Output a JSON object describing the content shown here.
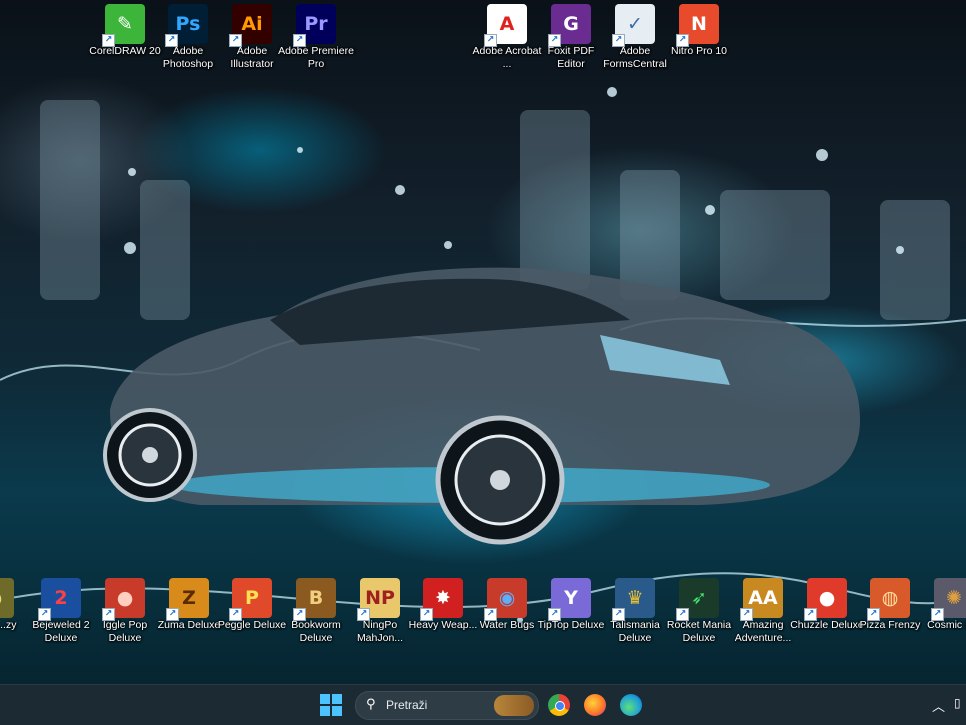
{
  "desktop": {
    "wallpaper": "car-water-splash",
    "top_icons": [
      {
        "name": "coreldraw",
        "label": "CorelDRAW 20",
        "glyph": "✎",
        "bg": "#3cb53a",
        "fg": "#ffffff"
      },
      {
        "name": "photoshop",
        "label": "Adobe Photoshop",
        "glyph": "Ps",
        "bg": "#001e36",
        "fg": "#31a8ff"
      },
      {
        "name": "illustrator",
        "label": "Adobe Illustrator",
        "glyph": "Ai",
        "bg": "#330000",
        "fg": "#ff9a00"
      },
      {
        "name": "premiere",
        "label": "Adobe Premiere Pro",
        "glyph": "Pr",
        "bg": "#00005b",
        "fg": "#9999ff"
      },
      {
        "name": "acrobat",
        "label": "Adobe Acrobat ...",
        "glyph": "A",
        "bg": "#ffffff",
        "fg": "#e0221f"
      },
      {
        "name": "foxit",
        "label": "Foxit PDF Editor",
        "glyph": "G",
        "bg": "#6b2c91",
        "fg": "#ffffff"
      },
      {
        "name": "formscentral",
        "label": "Adobe FormsCentral",
        "glyph": "✓",
        "bg": "#e6edf3",
        "fg": "#3d6ea5"
      },
      {
        "name": "nitro",
        "label": "Nitro Pro 10",
        "glyph": "N",
        "bg": "#e84a2c",
        "fg": "#ffffff"
      }
    ],
    "bottom_icons": [
      {
        "name": "amazing-frenzy",
        "label": "...ing ...zy",
        "glyph": "●",
        "bg": "#6d6a2a",
        "fg": "#e8d86a"
      },
      {
        "name": "bejeweled-2",
        "label": "Bejeweled 2 Deluxe",
        "glyph": "2",
        "bg": "#1a4fa0",
        "fg": "#ff4040"
      },
      {
        "name": "iggle-pop",
        "label": "Iggle Pop Deluxe",
        "glyph": "●",
        "bg": "#c83a2a",
        "fg": "#ffd0c0"
      },
      {
        "name": "zuma",
        "label": "Zuma Deluxe",
        "glyph": "Z",
        "bg": "#d88a1a",
        "fg": "#5a2a00"
      },
      {
        "name": "peggle",
        "label": "Peggle Deluxe",
        "glyph": "P",
        "bg": "#e04a2a",
        "fg": "#ffe050"
      },
      {
        "name": "bookworm",
        "label": "Bookworm Deluxe",
        "glyph": "B",
        "bg": "#8a5a20",
        "fg": "#f0d080"
      },
      {
        "name": "ningpo",
        "label": "NingPo MahJon...",
        "glyph": "NP",
        "bg": "#e8c86a",
        "fg": "#a02020"
      },
      {
        "name": "heavy-weapon",
        "label": "Heavy Weap...",
        "glyph": "✸",
        "bg": "#d02020",
        "fg": "#ffffff"
      },
      {
        "name": "water-bugs",
        "label": "Water Bugs",
        "glyph": "◉",
        "bg": "#c83a2a",
        "fg": "#5ab0ff"
      },
      {
        "name": "tiptop",
        "label": "TipTop Deluxe",
        "glyph": "Y",
        "bg": "#7a6ad8",
        "fg": "#ffffff"
      },
      {
        "name": "talismania",
        "label": "Talismania Deluxe",
        "glyph": "♛",
        "bg": "#2a5a8a",
        "fg": "#e8c030"
      },
      {
        "name": "rocket-mania",
        "label": "Rocket Mania Deluxe",
        "glyph": "➶",
        "bg": "#1a3a2a",
        "fg": "#40e070"
      },
      {
        "name": "amazing-adventures",
        "label": "Amazing Adventure...",
        "glyph": "AA",
        "bg": "#c88a20",
        "fg": "#ffffff"
      },
      {
        "name": "chuzzle",
        "label": "Chuzzle Deluxe",
        "glyph": "●",
        "bg": "#e03a2a",
        "fg": "#ffffff"
      },
      {
        "name": "pizza-frenzy",
        "label": "Pizza Frenzy",
        "glyph": "◍",
        "bg": "#d85a2a",
        "fg": "#ffe0a0"
      },
      {
        "name": "cosmic-bugs",
        "label": "Cosmic B...",
        "glyph": "✺",
        "bg": "#5a5a6a",
        "fg": "#e0a040"
      }
    ]
  },
  "taskbar": {
    "search_placeholder": "Pretraži",
    "search_glyph": "⚲",
    "tray_chevron": "︿",
    "apps": [
      {
        "name": "chrome",
        "color": "#e8b020"
      },
      {
        "name": "firefox",
        "color": "#ff7a2a"
      },
      {
        "name": "edge",
        "color": "#1ea0d8"
      }
    ]
  }
}
